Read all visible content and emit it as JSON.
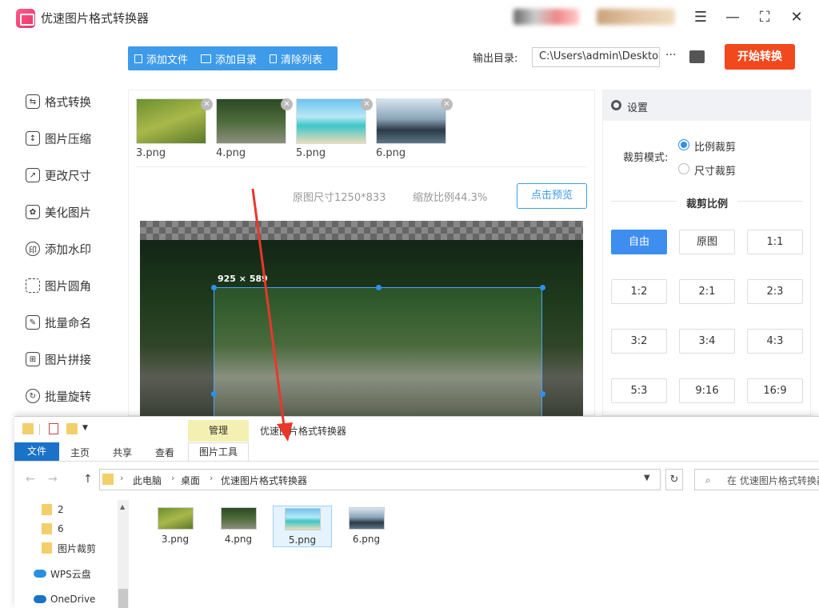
{
  "app": {
    "title": "优速图片格式转换器"
  },
  "sidebar": {
    "items": [
      {
        "label": "格式转换",
        "icon": "convert-icon"
      },
      {
        "label": "图片压缩",
        "icon": "compress-icon"
      },
      {
        "label": "更改尺寸",
        "icon": "resize-icon"
      },
      {
        "label": "美化图片",
        "icon": "beautify-icon"
      },
      {
        "label": "添加水印",
        "icon": "watermark-icon"
      },
      {
        "label": "图片圆角",
        "icon": "round-corner-icon"
      },
      {
        "label": "批量命名",
        "icon": "rename-icon"
      },
      {
        "label": "图片拼接",
        "icon": "stitch-icon"
      },
      {
        "label": "批量旋转",
        "icon": "rotate-icon"
      }
    ]
  },
  "toolbar": {
    "add_file": "添加文件",
    "add_dir": "添加目录",
    "clear_list": "清除列表"
  },
  "output": {
    "label": "输出目录:",
    "path": "C:\\Users\\admin\\Deskto",
    "more": "···",
    "start_button": "开始转换"
  },
  "thumbnails": [
    {
      "name": "3.png"
    },
    {
      "name": "4.png"
    },
    {
      "name": "5.png"
    },
    {
      "name": "6.png"
    }
  ],
  "preview": {
    "original_size": "原图尺寸1250*833",
    "scale": "缩放比例44.3%",
    "preview_button": "点击预览",
    "crop_size": "925 × 589"
  },
  "settings": {
    "title": "设置",
    "crop_mode_label": "裁剪模式:",
    "modes": [
      {
        "label": "比例裁剪",
        "selected": true
      },
      {
        "label": "尺寸裁剪",
        "selected": false
      }
    ],
    "ratio_title": "裁剪比例",
    "ratios": [
      {
        "label": "自由",
        "selected": true
      },
      {
        "label": "原图",
        "selected": false
      },
      {
        "label": "1:1",
        "selected": false
      },
      {
        "label": "1:2",
        "selected": false
      },
      {
        "label": "2:1",
        "selected": false
      },
      {
        "label": "2:3",
        "selected": false
      },
      {
        "label": "3:2",
        "selected": false
      },
      {
        "label": "3:4",
        "selected": false
      },
      {
        "label": "4:3",
        "selected": false
      },
      {
        "label": "5:3",
        "selected": false
      },
      {
        "label": "9:16",
        "selected": false
      },
      {
        "label": "16:9",
        "selected": false
      }
    ]
  },
  "explorer": {
    "context_tab": "管理",
    "title": "优速图片格式转换器",
    "tabs": {
      "file": "文件",
      "home": "主页",
      "share": "共享",
      "view": "查看",
      "tools": "图片工具"
    },
    "breadcrumb": [
      "此电脑",
      "桌面",
      "优速图片格式转换器"
    ],
    "search_placeholder": "在 优速图片格式转换器",
    "tree": [
      {
        "label": "2"
      },
      {
        "label": "6"
      },
      {
        "label": "图片裁剪"
      },
      {
        "label": "WPS云盘"
      },
      {
        "label": "OneDrive"
      }
    ],
    "files": [
      {
        "name": "3.png",
        "selected": false
      },
      {
        "name": "4.png",
        "selected": false
      },
      {
        "name": "5.png",
        "selected": true
      },
      {
        "name": "6.png",
        "selected": false
      }
    ]
  },
  "colors": {
    "accent": "#3e9bea",
    "start": "#f1491d",
    "selected_ratio": "#3e8ef0",
    "annotation_arrow": "#e8372b"
  }
}
